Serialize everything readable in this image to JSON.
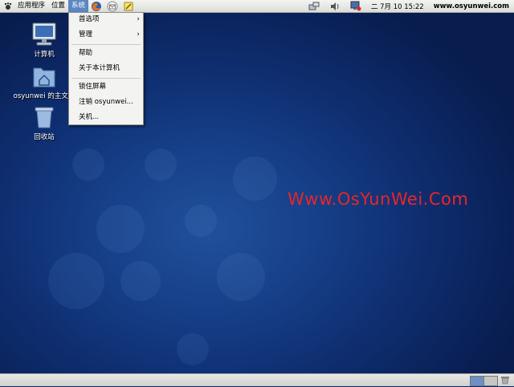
{
  "top_panel": {
    "menus": [
      "应用程序",
      "位置",
      "系统"
    ],
    "active_menu": "系统",
    "launchers": [
      "firefox-icon",
      "mail-icon",
      "notes-icon"
    ],
    "tray": {
      "icons": [
        "network-icon",
        "volume-icon",
        "update-icon"
      ],
      "date": "二 7月 10 15:22",
      "site": "www.osyunwei.com"
    }
  },
  "system_menu": {
    "items": [
      {
        "label": "首选项",
        "submenu": true
      },
      {
        "label": "管理",
        "submenu": true
      },
      {
        "label": "帮助",
        "submenu": false
      },
      {
        "label": "关于本计算机",
        "submenu": false
      },
      {
        "label": "锁住屏幕",
        "submenu": false
      },
      {
        "label": "注销 osyunwei...",
        "submenu": false
      },
      {
        "label": "关机...",
        "submenu": false
      }
    ],
    "submenu_arrow": "›"
  },
  "desktop": {
    "icons": [
      {
        "name": "computer-icon",
        "label": "计算机"
      },
      {
        "name": "home-folder-icon",
        "label": "osyunwei 的主文件"
      },
      {
        "name": "trash-icon",
        "label": "回收站"
      }
    ],
    "watermark": "Www.OsYunWei.Com"
  },
  "bottom_panel": {
    "workspaces": 2,
    "active_workspace": 1
  },
  "colors": {
    "desktop": "#17418a",
    "panel": "#dcdcd8",
    "menu_active": "#5b86c2",
    "watermark": "#e8252a"
  }
}
